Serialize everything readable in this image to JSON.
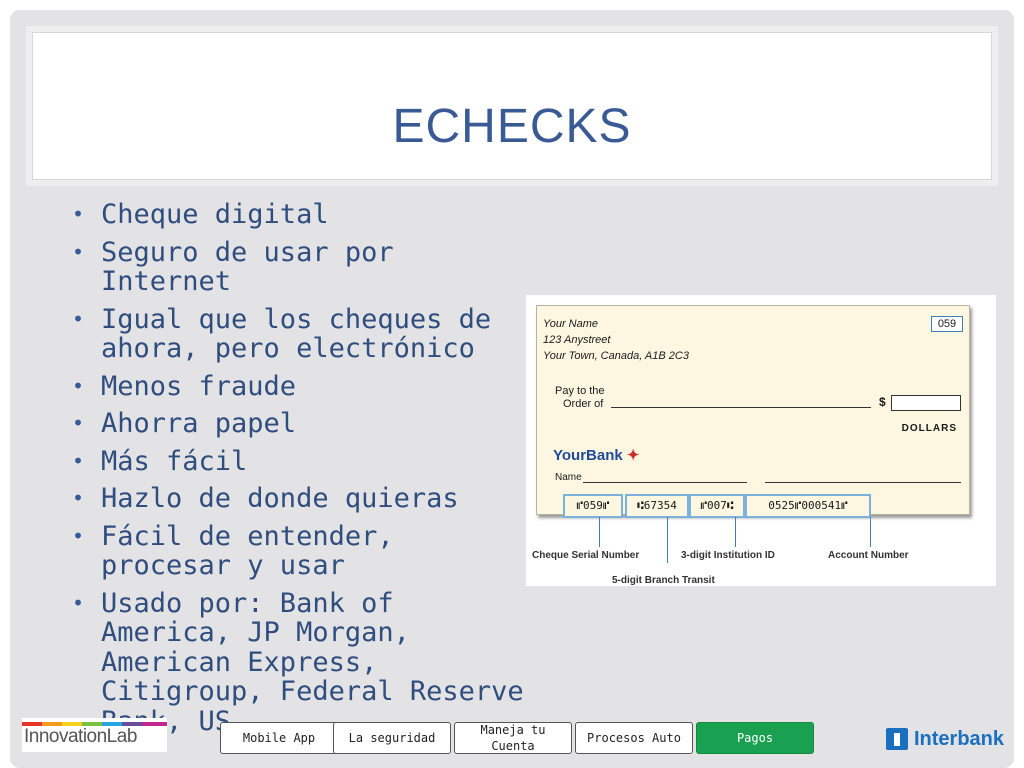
{
  "slide": {
    "title": "ECHECKS",
    "bullets": [
      "Cheque digital",
      "Seguro de usar por Internet",
      "Igual que los cheques de ahora, pero electrónico",
      "Menos fraude",
      "Ahorra papel",
      "Más fácil",
      "Hazlo de donde quieras",
      "Fácil de entender, procesar y usar",
      "Usado por: Bank of America, JP Morgan, American Express, Citigroup, Federal Reserve Bank, US"
    ]
  },
  "check_image": {
    "address": [
      "Your Name",
      "123 Anystreet",
      "Your Town, Canada, A1B 2C3"
    ],
    "check_number": "059",
    "pay_to": [
      "Pay to the",
      "Order of"
    ],
    "dollar_sign": "$",
    "dollars_label": "DOLLARS",
    "bank_name": "YourBank",
    "name_label": "Name",
    "micr": [
      "⑈059⑈",
      "⑆67354",
      "⑈007⑆",
      "0525⑈000541⑈"
    ],
    "labels": {
      "serial": "Cheque Serial Number",
      "institution": "3-digit Institution ID",
      "account": "Account Number",
      "branch": "5-digit Branch Transit"
    }
  },
  "footer": {
    "left_logo": "InnovationLab",
    "nav": [
      {
        "label": "Mobile App",
        "active": false
      },
      {
        "label": "La seguridad",
        "active": false
      },
      {
        "label": "Maneja tu Cuenta",
        "active": false
      },
      {
        "label": "Procesos Auto",
        "active": false
      },
      {
        "label": "Pagos",
        "active": true
      }
    ],
    "right_logo": "Interbank",
    "colors": {
      "active": "#1aa051",
      "brand_blue": "#1a6fc0",
      "title": "#3a5a95"
    }
  }
}
